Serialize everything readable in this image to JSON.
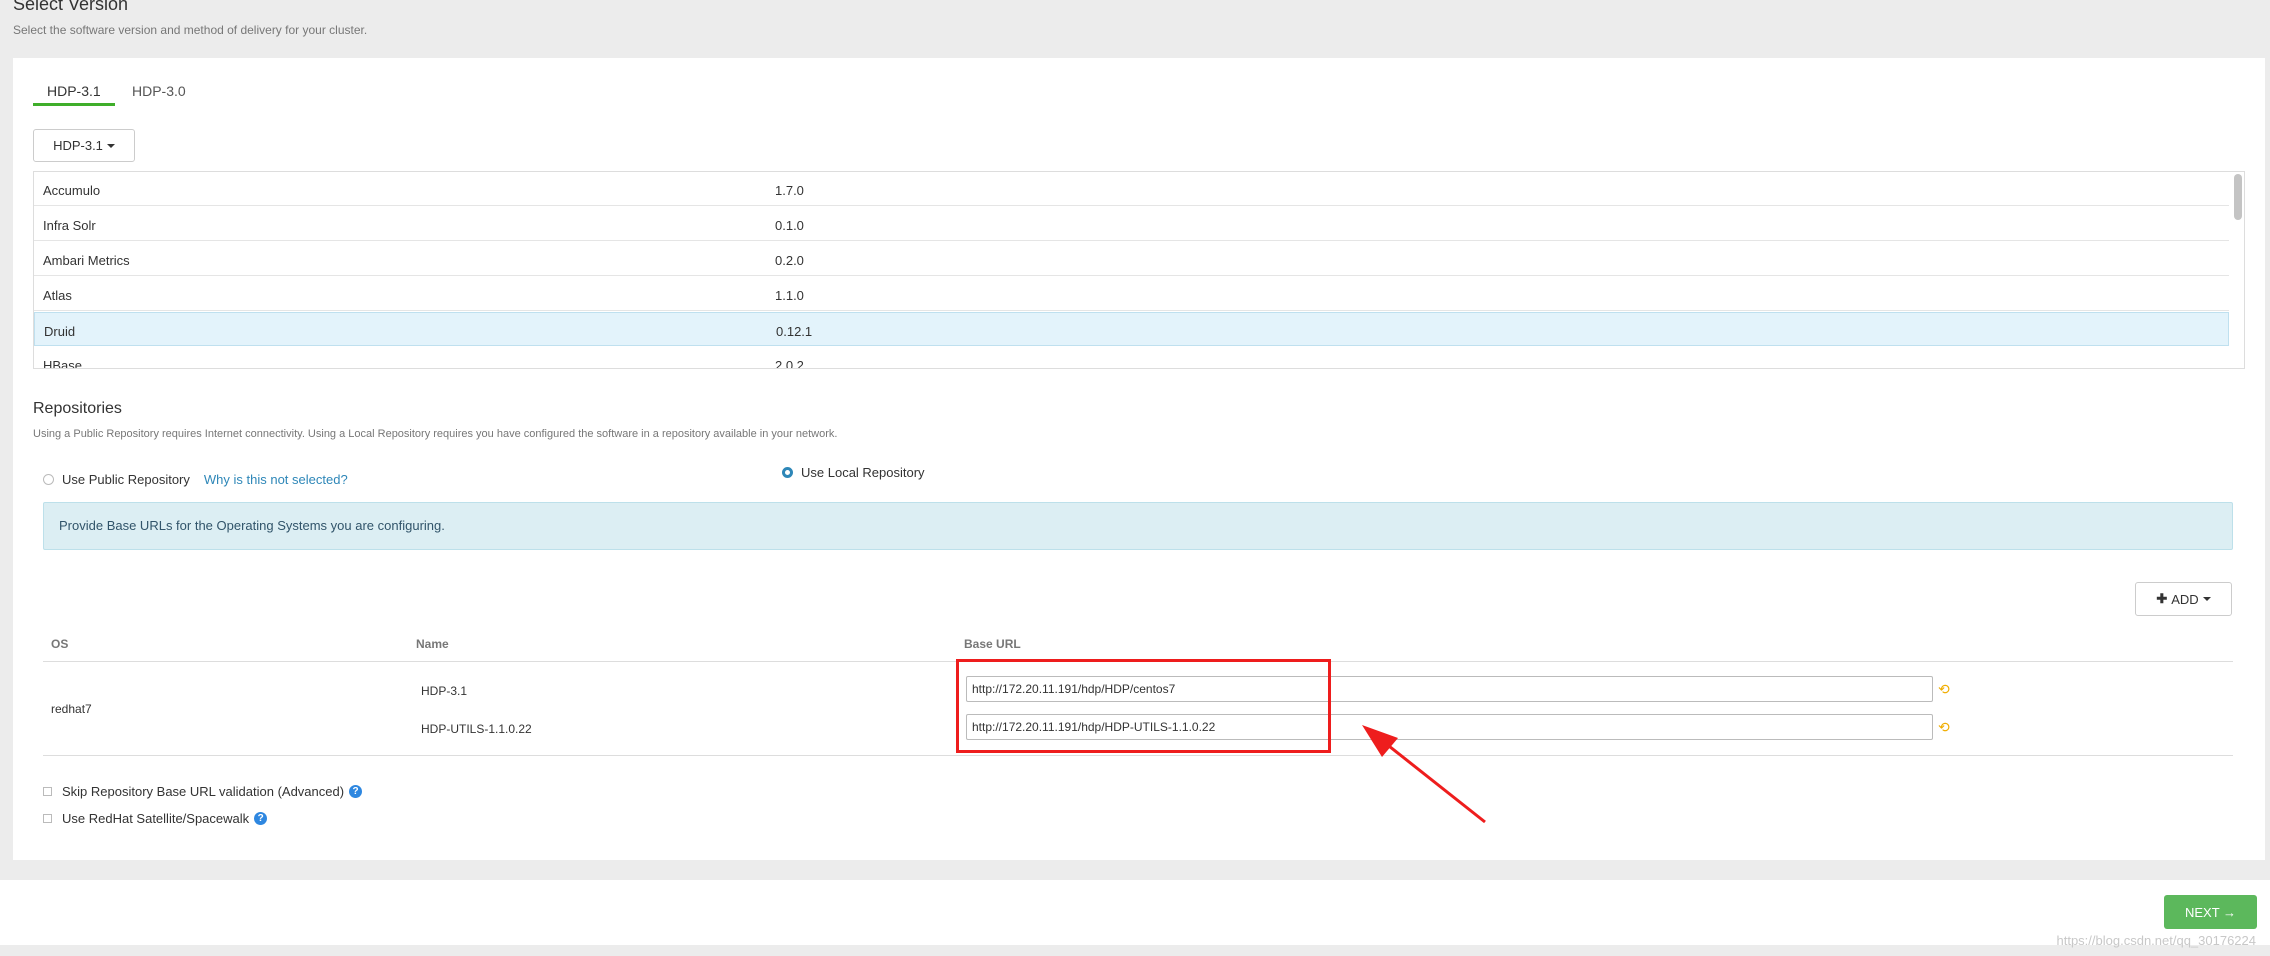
{
  "header": {
    "title": "Select Version",
    "subtitle": "Select the software version and method of delivery for your cluster."
  },
  "tabs": [
    {
      "label": "HDP-3.1",
      "active": true
    },
    {
      "label": "HDP-3.0",
      "active": false
    }
  ],
  "version_dropdown": {
    "selected": "HDP-3.1"
  },
  "stack_services": [
    {
      "name": "Accumulo",
      "version": "1.7.0"
    },
    {
      "name": "Infra Solr",
      "version": "0.1.0"
    },
    {
      "name": "Ambari Metrics",
      "version": "0.2.0"
    },
    {
      "name": "Atlas",
      "version": "1.1.0"
    },
    {
      "name": "Druid",
      "version": "0.12.1",
      "selected": true
    },
    {
      "name": "HBase",
      "version": "2.0.2"
    }
  ],
  "repositories": {
    "title": "Repositories",
    "description": "Using a Public Repository requires Internet connectivity. Using a Local Repository requires you have configured the software in a repository available in your network.",
    "public_option": {
      "label": "Use Public Repository",
      "selected": false
    },
    "why_link": "Why is this not selected?",
    "local_option": {
      "label": "Use Local Repository",
      "selected": true
    },
    "info": "Provide Base URLs for the Operating Systems you are configuring.",
    "add_button": "ADD",
    "columns": [
      "OS",
      "Name",
      "Base URL"
    ],
    "rows": [
      {
        "os": "redhat7",
        "repos": [
          {
            "name": "HDP-3.1",
            "base_url": "http://172.20.11.191/hdp/HDP/centos7"
          },
          {
            "name": "HDP-UTILS-1.1.0.22",
            "base_url": "http://172.20.11.191/hdp/HDP-UTILS-1.1.0.22"
          }
        ]
      }
    ],
    "skip_validation": {
      "label": "Skip Repository Base URL validation (Advanced)",
      "checked": false
    },
    "satellite": {
      "label": "Use RedHat Satellite/Spacewalk",
      "checked": false
    }
  },
  "footer": {
    "next_button": "NEXT →",
    "watermark": "https://blog.csdn.net/qq_30176224"
  },
  "colors": {
    "accent_green": "#3fae2a",
    "next_green": "#5cb85c",
    "link_blue": "#2e87b8",
    "annotation_red": "#ee1d1d",
    "undo_orange": "#f0ad00"
  }
}
